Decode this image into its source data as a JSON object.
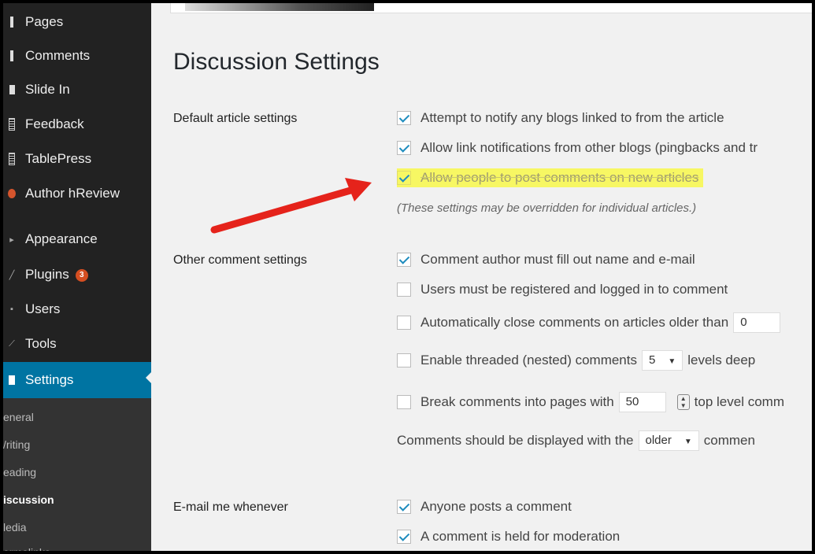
{
  "sidebar": {
    "items": [
      {
        "label": "Pages",
        "icon": "pages-icon"
      },
      {
        "label": "Comments",
        "icon": "comments-icon"
      },
      {
        "label": "Slide In",
        "icon": "slide-in-icon"
      },
      {
        "label": "Feedback",
        "icon": "feedback-icon"
      },
      {
        "label": "TablePress",
        "icon": "tablepress-icon"
      },
      {
        "label": "Author hReview",
        "icon": "author-hreview-icon"
      },
      {
        "label": "Appearance",
        "icon": "appearance-icon"
      },
      {
        "label": "Plugins",
        "icon": "plugins-icon",
        "badge": "3"
      },
      {
        "label": "Users",
        "icon": "users-icon"
      },
      {
        "label": "Tools",
        "icon": "tools-icon"
      },
      {
        "label": "Settings",
        "icon": "settings-icon",
        "active": true
      }
    ],
    "submenu": [
      "eneral",
      "/riting",
      "eading",
      "iscussion",
      "ledia",
      "ermalinks"
    ],
    "submenu_current": "iscussion"
  },
  "page": {
    "title": "Discussion Settings"
  },
  "sections": {
    "default_article": {
      "label": "Default article settings",
      "options": [
        {
          "text": "Attempt to notify any blogs linked to from the article",
          "checked": true
        },
        {
          "text": "Allow link notifications from other blogs (pingbacks and tr",
          "checked": true
        },
        {
          "text": "Allow people to post comments on new articles",
          "checked": true,
          "highlighted": true
        }
      ],
      "note": "(These settings may be overridden for individual articles.)"
    },
    "other_comment": {
      "label": "Other comment settings",
      "options": [
        {
          "text": "Comment author must fill out name and e-mail",
          "checked": true
        },
        {
          "text": "Users must be registered and logged in to comment",
          "checked": false
        },
        {
          "text": "Automatically close comments on articles older than",
          "checked": false,
          "field_value": "0"
        },
        {
          "text": "Enable threaded (nested) comments",
          "checked": false,
          "select_value": "5",
          "suffix": "levels deep"
        },
        {
          "text": "Break comments into pages with",
          "checked": false,
          "field_value": "50",
          "suffix": "top level comm"
        }
      ],
      "display_line": {
        "prefix": "Comments should be displayed with the",
        "select_value": "older",
        "suffix": "commen"
      }
    },
    "email": {
      "label": "E-mail me whenever",
      "options": [
        {
          "text": "Anyone posts a comment",
          "checked": true
        },
        {
          "text": "A comment is held for moderation",
          "checked": true
        }
      ]
    }
  },
  "colors": {
    "sidebar_bg": "#222222",
    "active_bg": "#0074a2",
    "highlight": "#f7f763",
    "arrow": "#e5231b",
    "badge": "#d54e21"
  }
}
